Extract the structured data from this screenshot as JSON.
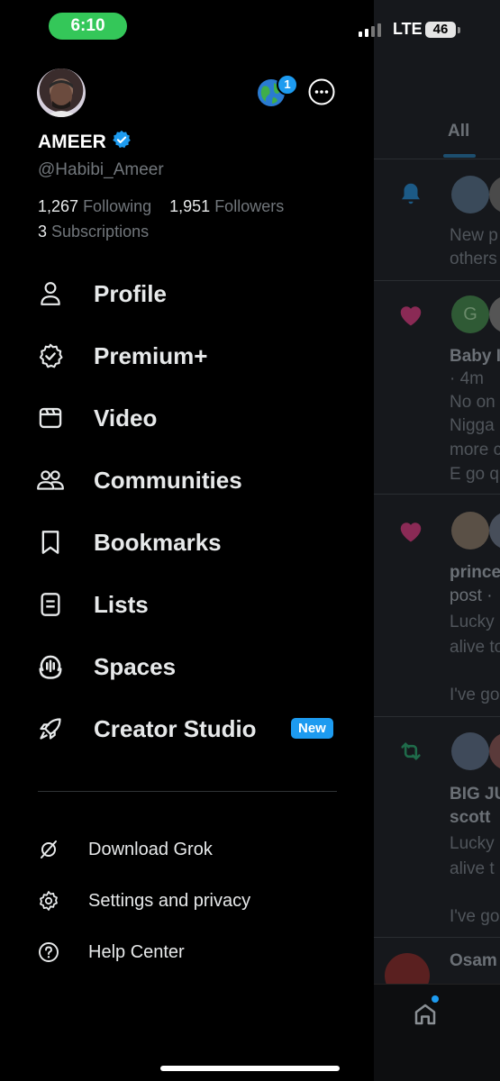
{
  "status_bar": {
    "time": "6:10",
    "network": "LTE",
    "battery": "46"
  },
  "profile": {
    "name": "AMEER",
    "handle": "@Habibi_Ameer",
    "following_count": "1,267",
    "following_label": "Following",
    "followers_count": "1,951",
    "followers_label": "Followers",
    "subscriptions_count": "3",
    "subscriptions_label": "Subscriptions",
    "notification_badge": "1"
  },
  "menu": [
    {
      "label": "Profile",
      "icon": "person-icon"
    },
    {
      "label": "Premium+",
      "icon": "premium-badge-icon"
    },
    {
      "label": "Video",
      "icon": "video-icon"
    },
    {
      "label": "Communities",
      "icon": "communities-icon"
    },
    {
      "label": "Bookmarks",
      "icon": "bookmark-icon"
    },
    {
      "label": "Lists",
      "icon": "list-icon"
    },
    {
      "label": "Spaces",
      "icon": "spaces-icon"
    },
    {
      "label": "Creator Studio",
      "icon": "rocket-icon",
      "badge": "New"
    }
  ],
  "secondary_menu": [
    {
      "label": "Download Grok",
      "icon": "grok-icon"
    },
    {
      "label": "Settings and privacy",
      "icon": "gear-icon"
    },
    {
      "label": "Help Center",
      "icon": "help-icon"
    }
  ],
  "feed": {
    "tab": "All",
    "snippets": {
      "n1_line1": "New p",
      "n1_line2": "others",
      "n2_avatar_letter": "G",
      "n2_title": "Baby I",
      "n2_time": "· 4m",
      "n2_line1": "No on",
      "n2_line2": "Nigga",
      "n2_line3": "more c",
      "n2_line4": "E go q",
      "n3_title": "prince",
      "n3_line1": "post ·",
      "n3_line2": "Lucky",
      "n3_line3": "alive to",
      "n3_line4": "I've go",
      "n4_title1": "BIG JU",
      "n4_title2": "scott",
      "n4_line1": "Lucky",
      "n4_line2": "alive t",
      "n4_line3": "I've go",
      "n5_title": "Osam"
    }
  },
  "colors": {
    "accent": "#1d9bf0",
    "status_time_bg": "#34c759",
    "drawer_bg": "#000000",
    "text": "#e7e9ea",
    "muted": "#71767b"
  }
}
